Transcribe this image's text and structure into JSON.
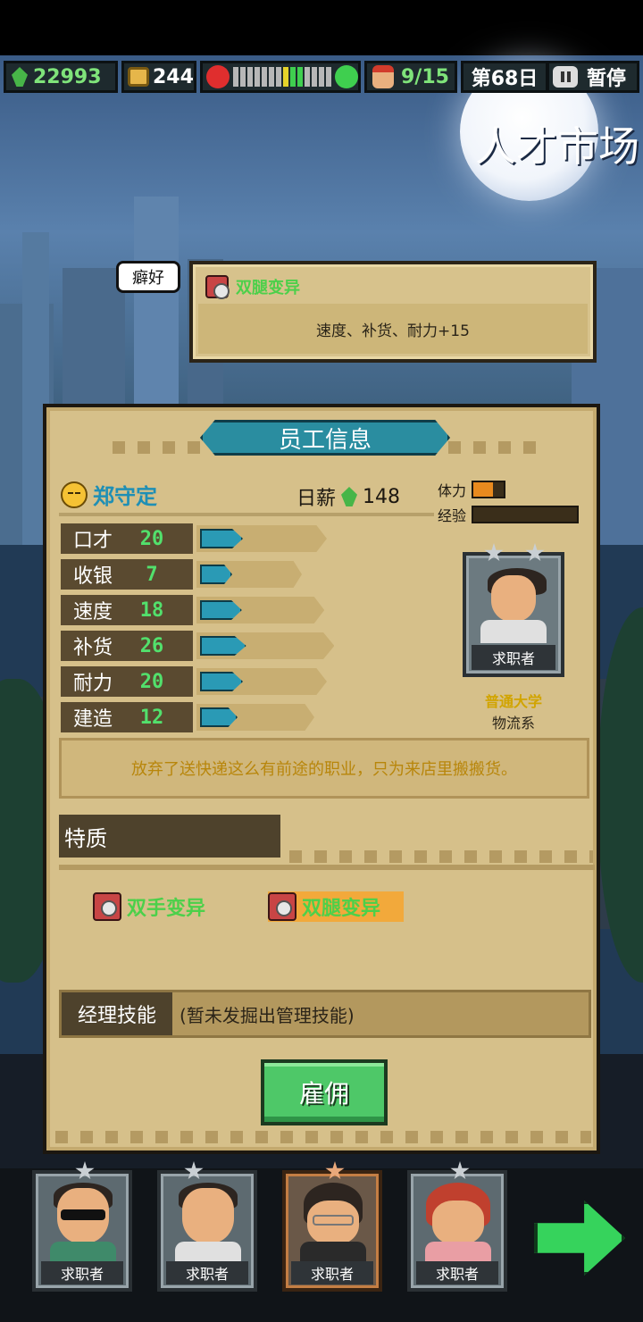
{
  "hud": {
    "money": "22993",
    "coins": "244",
    "mood_level": 0.6,
    "staff": "9/15",
    "day": "第68日",
    "pause_label": "暂停"
  },
  "scene_title": "人才市场",
  "hobby": {
    "tag": "癖好",
    "name": "双腿变异",
    "desc": "速度、补货、耐力+15"
  },
  "panel": {
    "title": "员工信息",
    "employee": {
      "name": "郑守定",
      "salary_label": "日薪",
      "salary": "148",
      "stamina_label": "体力",
      "stamina_level": 0.15,
      "exp_label": "经验",
      "exp_level": 0.0
    },
    "stats": [
      {
        "name": "口才",
        "value": "20",
        "level": 0.4
      },
      {
        "name": "收银",
        "value": "7",
        "level": 0.2
      },
      {
        "name": "速度",
        "value": "18",
        "level": 0.38
      },
      {
        "name": "补货",
        "value": "26",
        "level": 0.46
      },
      {
        "name": "耐力",
        "value": "20",
        "level": 0.4
      },
      {
        "name": "建造",
        "value": "12",
        "level": 0.3
      }
    ],
    "portrait_label": "求职者",
    "school": "普通大学",
    "major": "物流系",
    "quote": "放弃了送快递这么有前途的职业，只为来店里搬搬货。",
    "traits_title": "特质",
    "traits": [
      "双手变异",
      "双腿变异"
    ],
    "manager_label": "经理技能",
    "manager_value": "(暂未发掘出管理技能)",
    "hire_label": "雇佣"
  },
  "candidates": [
    {
      "label": "求职者"
    },
    {
      "label": "求职者"
    },
    {
      "label": "求职者"
    },
    {
      "label": "求职者"
    }
  ],
  "colors": {
    "panel_bg": "#d6c08a",
    "accent_teal": "#2a8da0",
    "stat_green": "#52e06c",
    "hire_green": "#4ec868"
  }
}
